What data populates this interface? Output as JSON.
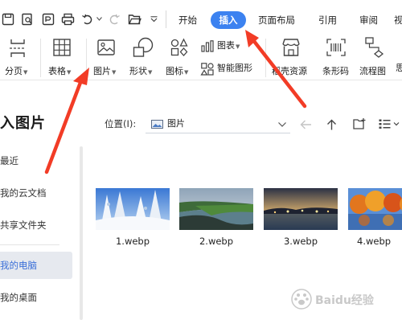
{
  "tabs": [
    {
      "label": "开始"
    },
    {
      "label": "插入",
      "active": true
    },
    {
      "label": "页面布局"
    },
    {
      "label": "引用"
    },
    {
      "label": "审阅"
    },
    {
      "label": "视"
    }
  ],
  "ribbon": {
    "pagebreak_label": "分页",
    "table_label": "表格",
    "picture_label": "图片",
    "shape_label": "形状",
    "icon_label": "图标",
    "chart_label": "图表",
    "smartart_label": "智能图形",
    "resources_label": "稻壳资源",
    "barcode_label": "条形码",
    "flowchart_label": "流程图"
  },
  "dialog": {
    "title": "入图片",
    "location_label": "位置(I):",
    "location_value": "图片"
  },
  "sidebar": {
    "items": [
      {
        "label": "最近"
      },
      {
        "label": "我的云文档"
      },
      {
        "label": "共享文件夹"
      },
      {
        "label": "我的电脑",
        "selected": true
      },
      {
        "label": "我的桌面"
      }
    ]
  },
  "files": [
    {
      "name": "1.webp"
    },
    {
      "name": "2.webp"
    },
    {
      "name": "3.webp"
    },
    {
      "name": "4.webp"
    }
  ],
  "watermark": {
    "text": "Baidu经验"
  },
  "colors": {
    "accent": "#3c82f0",
    "annotation_arrow": "#f23c26",
    "selected_item_bg": "#e6e9ef"
  }
}
